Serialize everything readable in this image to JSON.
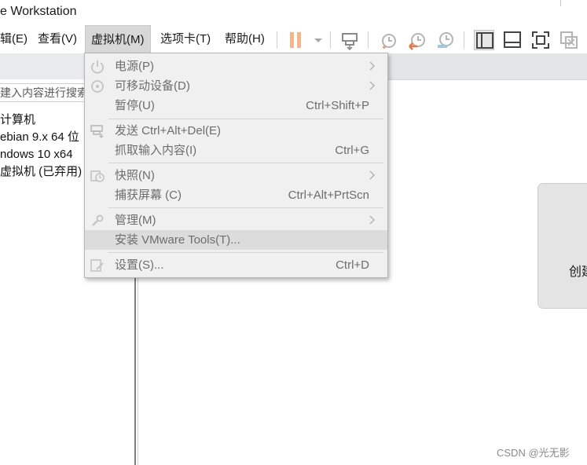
{
  "window": {
    "title": "e Workstation"
  },
  "menubar": {
    "edit": "辑(E)",
    "view": "查看(V)",
    "vm": "虚拟机(M)",
    "tabs": "选项卡(T)",
    "help": "帮助(H)"
  },
  "toolbar": [
    {
      "icon": "pause-icon"
    },
    {
      "icon": "dropdown-arrow-icon"
    },
    {
      "icon": "send-ctrl-alt-del-icon"
    },
    {
      "icon": "snapshot-take-icon"
    },
    {
      "icon": "snapshot-revert-icon"
    },
    {
      "icon": "snapshot-manager-icon"
    },
    {
      "icon": "show-library-icon"
    },
    {
      "icon": "show-thumbnail-bar-icon"
    },
    {
      "icon": "full-screen-icon"
    },
    {
      "icon": "unity-icon"
    }
  ],
  "library": {
    "search_placeholder": "建入内容进行搜索",
    "nodes": [
      "计算机",
      "ebian 9.x 64 位",
      "ndows 10 x64",
      "虚拟机 (已弃用)"
    ]
  },
  "home": {
    "card_label": "创建"
  },
  "vm_menu": {
    "items": [
      {
        "label": "电源(P)",
        "shortcut": "",
        "submenu": true,
        "icon": "power-icon"
      },
      {
        "label": "可移动设备(D)",
        "shortcut": "",
        "submenu": true,
        "icon": "disc-icon"
      },
      {
        "label": "暂停(U)",
        "shortcut": "Ctrl+Shift+P",
        "submenu": false,
        "icon": ""
      },
      {
        "label": "发送 Ctrl+Alt+Del(E)",
        "shortcut": "",
        "submenu": false,
        "icon": "send-keys-icon"
      },
      {
        "label": "抓取输入内容(I)",
        "shortcut": "Ctrl+G",
        "submenu": false,
        "icon": ""
      },
      {
        "label": "快照(N)",
        "shortcut": "",
        "submenu": true,
        "icon": "snapshot-icon"
      },
      {
        "label": "捕获屏幕 (C)",
        "shortcut": "Ctrl+Alt+PrtScn",
        "submenu": false,
        "icon": ""
      },
      {
        "label": "管理(M)",
        "shortcut": "",
        "submenu": true,
        "icon": "wrench-icon"
      },
      {
        "label": "安装 VMware Tools(T)...",
        "shortcut": "",
        "submenu": false,
        "icon": "",
        "highlighted": true
      },
      {
        "label": "设置(S)...",
        "shortcut": "Ctrl+D",
        "submenu": false,
        "icon": "settings-icon"
      }
    ]
  },
  "watermark": "CSDN @光无影",
  "colors": {
    "pause": "#f4a76a",
    "accent": "#e07a4a",
    "disabled_text": "#6d6d6d",
    "menu_bg": "#f0f0f0"
  }
}
